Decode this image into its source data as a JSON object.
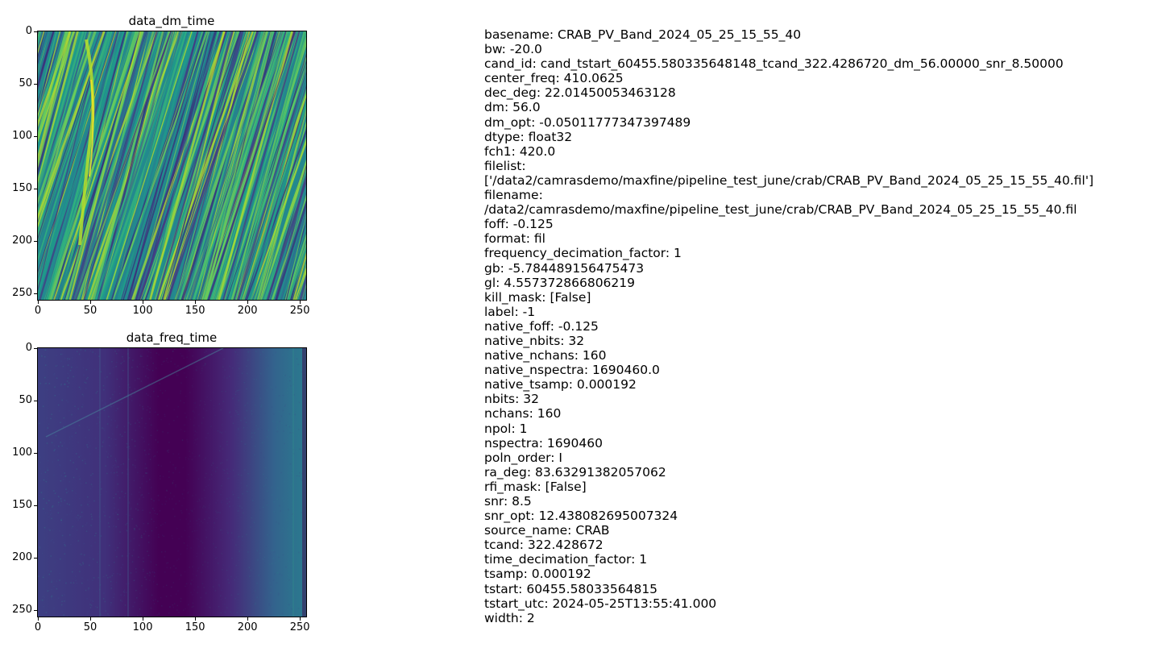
{
  "chart_data": [
    {
      "type": "heatmap",
      "title": "data_dm_time",
      "xlabel": "",
      "ylabel": "",
      "xlim": [
        0,
        256
      ],
      "ylim": [
        256,
        0
      ],
      "x_ticks": [
        "0",
        "50",
        "100",
        "150",
        "200",
        "250"
      ],
      "y_ticks": [
        "0",
        "50",
        "100",
        "150",
        "200",
        "250"
      ],
      "colormap": "viridis",
      "pattern": "diagonal dispersed streaks tilted to the right, brightest streak around x≈40-60 from y≈60 to y≈200",
      "colors": {
        "low": "#3b2b7a",
        "mid": "#21908d",
        "high": "#b5de2b"
      }
    },
    {
      "type": "heatmap",
      "title": "data_freq_time",
      "xlabel": "",
      "ylabel": "",
      "xlim": [
        0,
        256
      ],
      "ylim": [
        256,
        0
      ],
      "x_ticks": [
        "0",
        "50",
        "100",
        "150",
        "200",
        "250"
      ],
      "y_ticks": [
        "0",
        "50",
        "100",
        "150",
        "200",
        "250"
      ],
      "colormap": "viridis",
      "pattern": "dark purple band centered near x≈150, brighter teal toward right edge, faint dispersed sweep top-left",
      "colors": {
        "low": "#440154",
        "mid": "#3b528b",
        "high": "#21908d"
      }
    }
  ],
  "metadata_lines": [
    "basename: CRAB_PV_Band_2024_05_25_15_55_40",
    "bw: -20.0",
    "cand_id: cand_tstart_60455.580335648148_tcand_322.4286720_dm_56.00000_snr_8.50000",
    "center_freq: 410.0625",
    "dec_deg: 22.01450053463128",
    "dm: 56.0",
    "dm_opt: -0.05011777347397489",
    "dtype: float32",
    "fch1: 420.0",
    "filelist:",
    "['/data2/camrasdemo/maxfine/pipeline_test_june/crab/CRAB_PV_Band_2024_05_25_15_55_40.fil']",
    "filename:",
    "/data2/camrasdemo/maxfine/pipeline_test_june/crab/CRAB_PV_Band_2024_05_25_15_55_40.fil",
    "foff: -0.125",
    "format: fil",
    "frequency_decimation_factor: 1",
    "gb: -5.784489156475473",
    "gl: 4.557372866806219",
    "kill_mask: [False]",
    "label: -1",
    "native_foff: -0.125",
    "native_nbits: 32",
    "native_nchans: 160",
    "native_nspectra: 1690460.0",
    "native_tsamp: 0.000192",
    "nbits: 32",
    "nchans: 160",
    "npol: 1",
    "nspectra: 1690460",
    "poln_order: I",
    "ra_deg: 83.63291382057062",
    "rfi_mask: [False]",
    "snr: 8.5",
    "snr_opt: 12.438082695007324",
    "source_name: CRAB",
    "tcand: 322.428672",
    "time_decimation_factor: 1",
    "tsamp: 0.000192",
    "tstart: 60455.58033564815",
    "tstart_utc: 2024-05-25T13:55:41.000",
    "width: 2"
  ]
}
